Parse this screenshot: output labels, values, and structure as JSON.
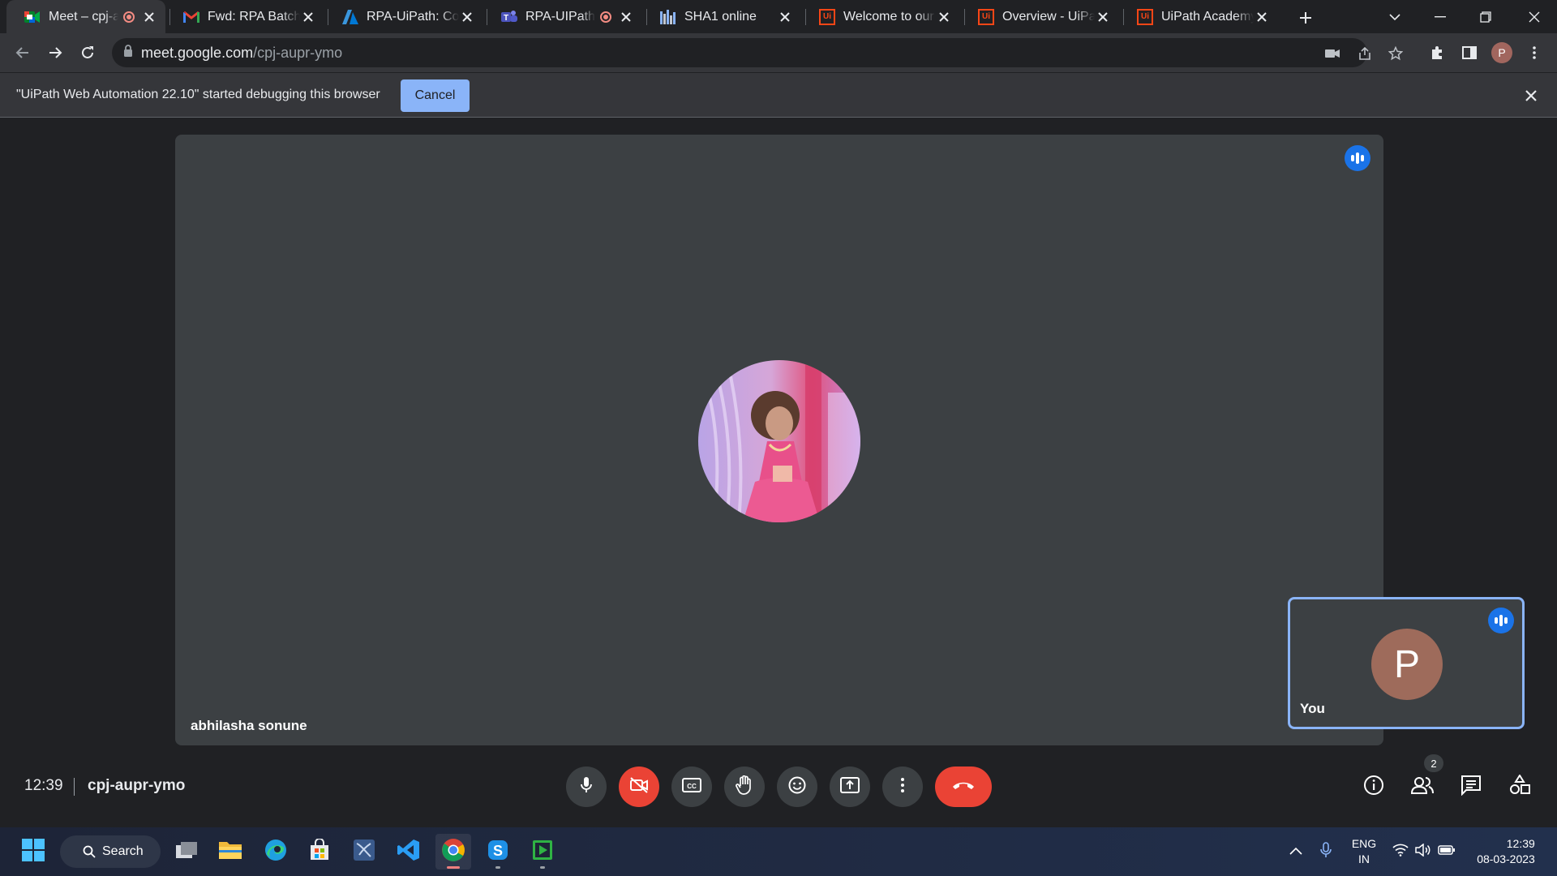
{
  "browser": {
    "tabs": [
      {
        "title": "Meet – cpj-aupr-ymo",
        "favicon": "google-meet-icon",
        "recording": true,
        "active": true
      },
      {
        "title": "Fwd: RPA Batch | UiPath",
        "favicon": "gmail-icon",
        "recording": false
      },
      {
        "title": "RPA-UiPath: Course",
        "favicon": "azure-devops-icon",
        "recording": false
      },
      {
        "title": "RPA-UIPath Training",
        "favicon": "teams-icon",
        "recording": true
      },
      {
        "title": "SHA1 online",
        "favicon": "sha1-icon",
        "recording": false
      },
      {
        "title": "Welcome to our UiPath",
        "favicon": "uipath-icon",
        "recording": false
      },
      {
        "title": "Overview - UiPath",
        "favicon": "uipath-icon",
        "recording": false
      },
      {
        "title": "UiPath Academy",
        "favicon": "uipath-icon",
        "recording": false
      }
    ],
    "url_host": "meet.google.com",
    "url_path": "/cpj-aupr-ymo",
    "profile_initial": "P"
  },
  "infobar": {
    "message": "\"UiPath Web Automation 22.10\" started debugging this browser",
    "cancel_label": "Cancel"
  },
  "meet": {
    "main_participant": "abhilasha sonune",
    "self_label": "You",
    "self_initial": "P",
    "time": "12:39",
    "meeting_code": "cpj-aupr-ymo",
    "participant_count": "2",
    "colors": {
      "accent": "#8ab4f8",
      "danger": "#ea4335",
      "speaking": "#1a73e8",
      "tile": "#3c4043"
    }
  },
  "taskbar": {
    "search_label": "Search",
    "lang_top": "ENG",
    "lang_bottom": "IN",
    "clock_time": "12:39",
    "clock_date": "08-03-2023"
  }
}
